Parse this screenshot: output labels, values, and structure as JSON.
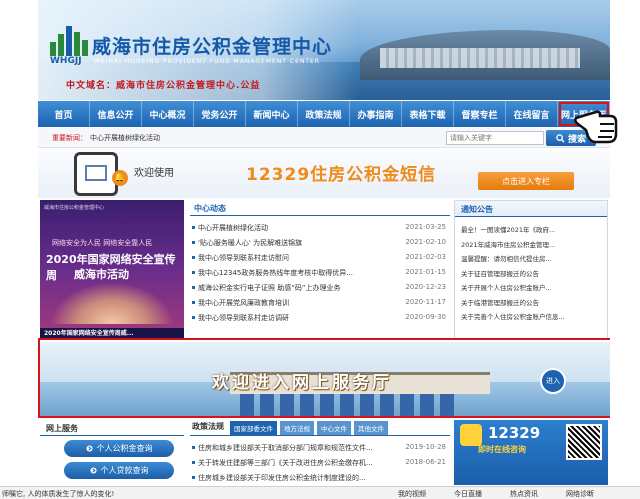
{
  "header": {
    "logo_text": "WHGJJ",
    "site_name": "威海市住房公积金管理中心",
    "site_name_en": "WEIHAI HOUSING PROVIDENT FUND MANAGEMENT CENTER",
    "slogan": "中文域名：威海市住房公积金管理中心.公益"
  },
  "nav": {
    "items": [
      {
        "label": "首页"
      },
      {
        "label": "信息公开"
      },
      {
        "label": "中心概况"
      },
      {
        "label": "党务公开"
      },
      {
        "label": "新闻中心"
      },
      {
        "label": "政策法规"
      },
      {
        "label": "办事指南"
      },
      {
        "label": "表格下载"
      },
      {
        "label": "督察专栏"
      },
      {
        "label": "在线留言"
      },
      {
        "label": "网上服务厅"
      }
    ]
  },
  "newsbar": {
    "label": "重要新闻：",
    "text": "中心开展植树绿化活动"
  },
  "search": {
    "placeholder": "请输入关键字",
    "button_label": "搜索"
  },
  "welcome": {
    "text": "欢迎使用",
    "sms": "12329住房公积金短信",
    "enter_label": "点击进入专栏"
  },
  "promo": {
    "top": "威海市住房公积金管理中心",
    "line1": "网络安全为人民 网络安全靠人民",
    "line2": "2020年国家网络安全宣传周",
    "line3": "威海市活动",
    "caption": "2020年国家网络安全宣传周威..."
  },
  "center_news": {
    "title": "中心动态",
    "items": [
      {
        "title": "中心开展植树绿化活动",
        "date": "2021-03-25"
      },
      {
        "title": "'贴心服务暖人心' 为民解难送锦旗",
        "date": "2021-02-10"
      },
      {
        "title": "我中心领导到联系村走访慰问",
        "date": "2021-02-03"
      },
      {
        "title": "我中心12345政务服务热线年度考核中取得优异...",
        "date": "2021-01-15"
      },
      {
        "title": "威海公积金实行电子证照 助感“码”上办理业务",
        "date": "2020-12-23"
      },
      {
        "title": "我中心开展党风廉政教育培训",
        "date": "2020-11-17"
      },
      {
        "title": "我中心领导到联系村走访调研",
        "date": "2020-09-30"
      }
    ]
  },
  "notice": {
    "title": "通知公告",
    "items": [
      {
        "title": "最全！一图读懂2021年《政府..."
      },
      {
        "title": "2021年威海市住房公积金管理..."
      },
      {
        "title": "温馨提醒：请勿相信代提住房..."
      },
      {
        "title": "关于征召管理部搬迁的公告"
      },
      {
        "title": "关于开展个人住房公积金账户..."
      },
      {
        "title": "关于临港管理部搬迁的公告"
      },
      {
        "title": "关于完善个人住房公积金账户信息..."
      }
    ]
  },
  "online_hall": {
    "text": "欢迎进入网上服务厅",
    "enter_label": "进入"
  },
  "online_service": {
    "title": "网上服务",
    "buttons": [
      {
        "label": "个人公积金查询"
      },
      {
        "label": "个人贷款查询"
      }
    ]
  },
  "policy": {
    "title": "政策法规",
    "tabs": [
      {
        "label": "国家部委文件"
      },
      {
        "label": "地方法规"
      },
      {
        "label": "中心文件"
      },
      {
        "label": "其他文件"
      }
    ],
    "items": [
      {
        "title": "住房和城乡建设部关于取消部分部门规章和规范性文件...",
        "date": "2019-10-28"
      },
      {
        "title": "关于转发住建部等三部门《关于改进住房公积金缴存机...",
        "date": "2018-06-21"
      },
      {
        "title": "住房城乡建设部关于印发住房公积金统计制度建设的..."
      }
    ]
  },
  "qr": {
    "number": "12329",
    "subtitle": "即时在线咨询"
  },
  "taskbar": {
    "left_text": "师嘱它, 人的体质发生了惊人的变化!",
    "items": [
      {
        "label": "我的视频"
      },
      {
        "label": "今日直播"
      },
      {
        "label": "热点资讯"
      },
      {
        "label": "网络诊断"
      }
    ]
  }
}
